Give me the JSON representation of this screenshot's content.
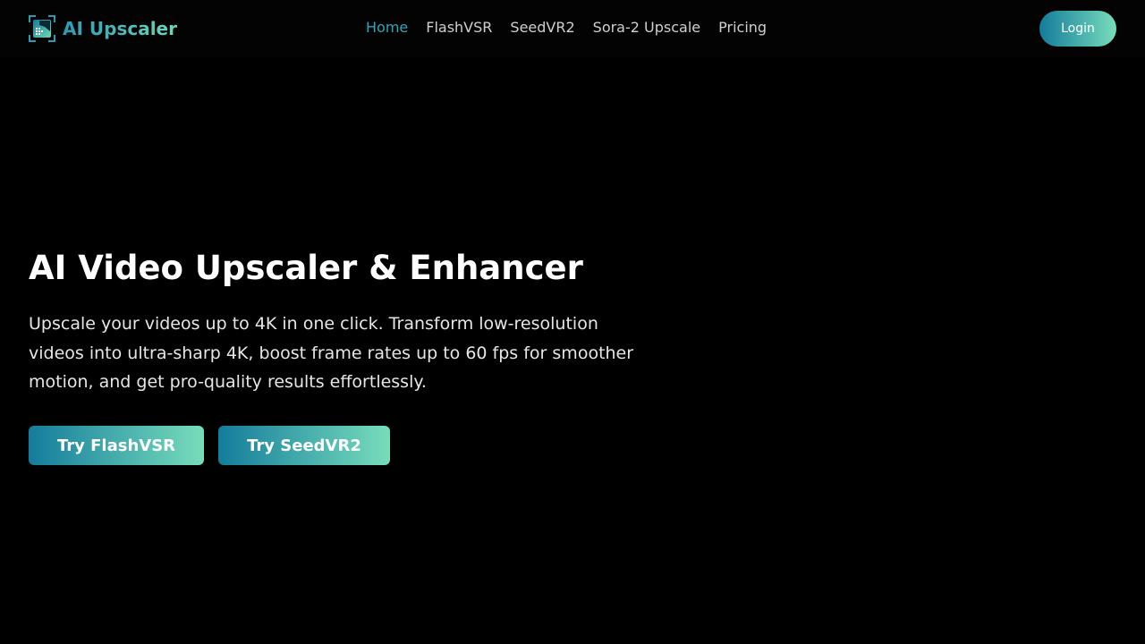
{
  "brand": {
    "name": "AI Upscaler",
    "logo_icon": "image-enhance-icon",
    "gradient_start": "#2a9bb5",
    "gradient_end": "#6fd6b8"
  },
  "nav": {
    "items": [
      {
        "label": "Home",
        "active": true
      },
      {
        "label": "FlashVSR",
        "active": false
      },
      {
        "label": "SeedVR2",
        "active": false
      },
      {
        "label": "Sora-2 Upscale",
        "active": false
      },
      {
        "label": "Pricing",
        "active": false
      }
    ],
    "active_color": "#2fa4b8"
  },
  "header": {
    "login_label": "Login"
  },
  "hero": {
    "title": "AI Video Upscaler & Enhancer",
    "description": "Upscale your videos up to 4K in one click. Transform low-resolution videos into ultra-sharp 4K, boost frame rates up to 60 fps for smoother motion, and get pro-quality results effortlessly.",
    "buttons": [
      {
        "label": "Try FlashVSR"
      },
      {
        "label": "Try SeedVR2"
      }
    ]
  },
  "colors": {
    "background": "#000000",
    "button_gradient_start": "#147c9c",
    "button_gradient_end": "#78ddbb"
  }
}
